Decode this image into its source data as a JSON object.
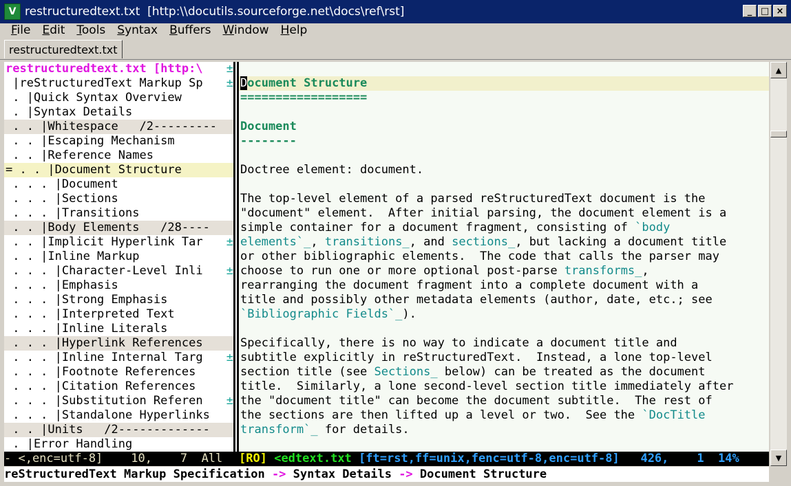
{
  "window": {
    "icon_label": "V",
    "title": "restructuredtext.txt  [http:\\\\docutils.sourceforge.net\\docs\\ref\\rst]",
    "minimize": "_",
    "maximize": "□",
    "close": "×"
  },
  "menu": [
    {
      "pre": "",
      "u": "F",
      "post": "ile"
    },
    {
      "pre": "",
      "u": "E",
      "post": "dit"
    },
    {
      "pre": "",
      "u": "T",
      "post": "ools"
    },
    {
      "pre": "",
      "u": "S",
      "post": "yntax"
    },
    {
      "pre": "",
      "u": "B",
      "post": "uffers"
    },
    {
      "pre": "",
      "u": "W",
      "post": "indow"
    },
    {
      "pre": "",
      "u": "H",
      "post": "elp"
    }
  ],
  "tab": {
    "label": "restructuredtext.txt"
  },
  "outline": {
    "header": "restructuredtext.txt [http:\\",
    "lines": [
      {
        "text": " |reStructuredText Markup Sp",
        "plus": true,
        "style": ""
      },
      {
        "text": " . |Quick Syntax Overview",
        "plus": false,
        "style": ""
      },
      {
        "text": " . |Syntax Details",
        "plus": false,
        "style": ""
      },
      {
        "text": " . . |Whitespace   /2---------",
        "plus": false,
        "style": "fold"
      },
      {
        "text": " . . |Escaping Mechanism",
        "plus": false,
        "style": ""
      },
      {
        "text": " . . |Reference Names",
        "plus": false,
        "style": ""
      },
      {
        "text": "= . . |Document Structure",
        "plus": false,
        "style": "cur",
        "raw": true
      },
      {
        "text": " . . . |Document",
        "plus": false,
        "style": ""
      },
      {
        "text": " . . . |Sections",
        "plus": false,
        "style": ""
      },
      {
        "text": " . . . |Transitions",
        "plus": false,
        "style": ""
      },
      {
        "text": " . . |Body Elements   /28----",
        "plus": false,
        "style": "fold"
      },
      {
        "text": " . . |Implicit Hyperlink Tar",
        "plus": true,
        "style": ""
      },
      {
        "text": " . . |Inline Markup",
        "plus": false,
        "style": ""
      },
      {
        "text": " . . . |Character-Level Inli",
        "plus": true,
        "style": ""
      },
      {
        "text": " . . . |Emphasis",
        "plus": false,
        "style": ""
      },
      {
        "text": " . . . |Strong Emphasis",
        "plus": false,
        "style": ""
      },
      {
        "text": " . . . |Interpreted Text",
        "plus": false,
        "style": ""
      },
      {
        "text": " . . . |Inline Literals",
        "plus": false,
        "style": ""
      },
      {
        "text": " . . . |Hyperlink References",
        "plus": false,
        "style": "fold"
      },
      {
        "text": " . . . |Inline Internal Targ",
        "plus": true,
        "style": ""
      },
      {
        "text": " . . . |Footnote References",
        "plus": false,
        "style": ""
      },
      {
        "text": " . . . |Citation References",
        "plus": false,
        "style": ""
      },
      {
        "text": " . . . |Substitution Referen",
        "plus": true,
        "style": ""
      },
      {
        "text": " . . . |Standalone Hyperlinks",
        "plus": false,
        "style": ""
      },
      {
        "text": " . . |Units   /2-------------",
        "plus": false,
        "style": "fold"
      },
      {
        "text": " . |Error Handling",
        "plus": false,
        "style": ""
      }
    ]
  },
  "doc": {
    "lines": [
      [
        {
          "t": ""
        }
      ],
      [
        {
          "t": "D",
          "c": "cursor"
        },
        {
          "t": "ocument Structure",
          "c": "green"
        }
      ],
      [
        {
          "t": "==================",
          "c": "green"
        }
      ],
      [
        {
          "t": ""
        }
      ],
      [
        {
          "t": "Document",
          "c": "green"
        }
      ],
      [
        {
          "t": "--------",
          "c": "green"
        }
      ],
      [
        {
          "t": ""
        }
      ],
      [
        {
          "t": "Doctree element: document."
        }
      ],
      [
        {
          "t": ""
        }
      ],
      [
        {
          "t": "The top-level element of a parsed reStructuredText document is the"
        }
      ],
      [
        {
          "t": "\"document\" element.  After initial parsing, the document element is a"
        }
      ],
      [
        {
          "t": "simple container for a document fragment, consisting of "
        },
        {
          "t": "`body",
          "c": "link"
        }
      ],
      [
        {
          "t": "elements`_",
          "c": "link"
        },
        {
          "t": ", "
        },
        {
          "t": "transitions_",
          "c": "link"
        },
        {
          "t": ", and "
        },
        {
          "t": "sections_",
          "c": "link"
        },
        {
          "t": ", but lacking a document title"
        }
      ],
      [
        {
          "t": "or other bibliographic elements.  The code that calls the parser may"
        }
      ],
      [
        {
          "t": "choose to run one or more optional post-parse "
        },
        {
          "t": "transforms_",
          "c": "link"
        },
        {
          "t": ","
        }
      ],
      [
        {
          "t": "rearranging the document fragment into a complete document with a"
        }
      ],
      [
        {
          "t": "title and possibly other metadata elements (author, date, etc.; see"
        }
      ],
      [
        {
          "t": "`Bibliographic Fields`_",
          "c": "link"
        },
        {
          "t": ")."
        }
      ],
      [
        {
          "t": ""
        }
      ],
      [
        {
          "t": "Specifically, there is no way to indicate a document title and"
        }
      ],
      [
        {
          "t": "subtitle explicitly in reStructuredText.  Instead, a lone top-level"
        }
      ],
      [
        {
          "t": "section title (see "
        },
        {
          "t": "Sections_",
          "c": "link"
        },
        {
          "t": " below) can be treated as the document"
        }
      ],
      [
        {
          "t": "title.  Similarly, a lone second-level section title immediately after"
        }
      ],
      [
        {
          "t": "the \"document title\" can become the document subtitle.  The rest of"
        }
      ],
      [
        {
          "t": "the sections are then lifted up a level or two.  See the "
        },
        {
          "t": "`DocTitle",
          "c": "link"
        }
      ],
      [
        {
          "t": "transform`_",
          "c": "link"
        },
        {
          "t": " for details."
        }
      ],
      [
        {
          "t": ""
        }
      ]
    ]
  },
  "status": {
    "left": "- <,enc=utf-8]    10,    7  All",
    "ro": "[RO]",
    "file": "<edtext.txt",
    "enc": "[ft=rst,ff=unix,fenc=utf-8,enc=utf-8]",
    "pos": "   426,    1  14%"
  },
  "breadcrumb": {
    "a": "reStructuredText Markup Specification",
    "sep": " -> ",
    "b": "Syntax Details",
    "c": "Document Structure"
  },
  "colors": {
    "titlebar": "#0a246a",
    "heading_green": "#1a8a5a",
    "link_teal": "#128a8a",
    "fold_marker": "#1aa59a",
    "header_magenta": "#e016e0"
  }
}
